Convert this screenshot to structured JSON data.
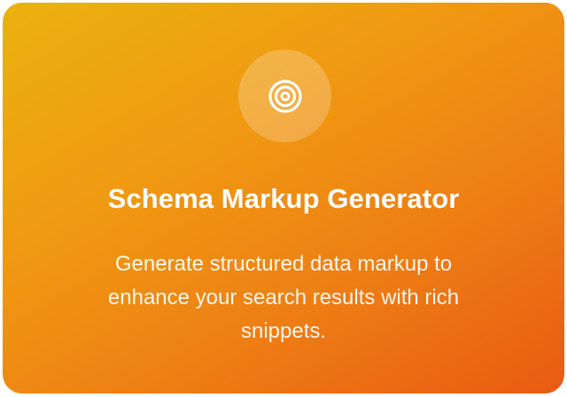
{
  "card": {
    "icon": "target-icon",
    "title": "Schema Markup Generator",
    "description": "Generate structured data markup to enhance your search results with rich snippets."
  },
  "colors": {
    "gradient_start": "#eab20f",
    "gradient_end": "#e95b12",
    "text": "#ffffff"
  }
}
